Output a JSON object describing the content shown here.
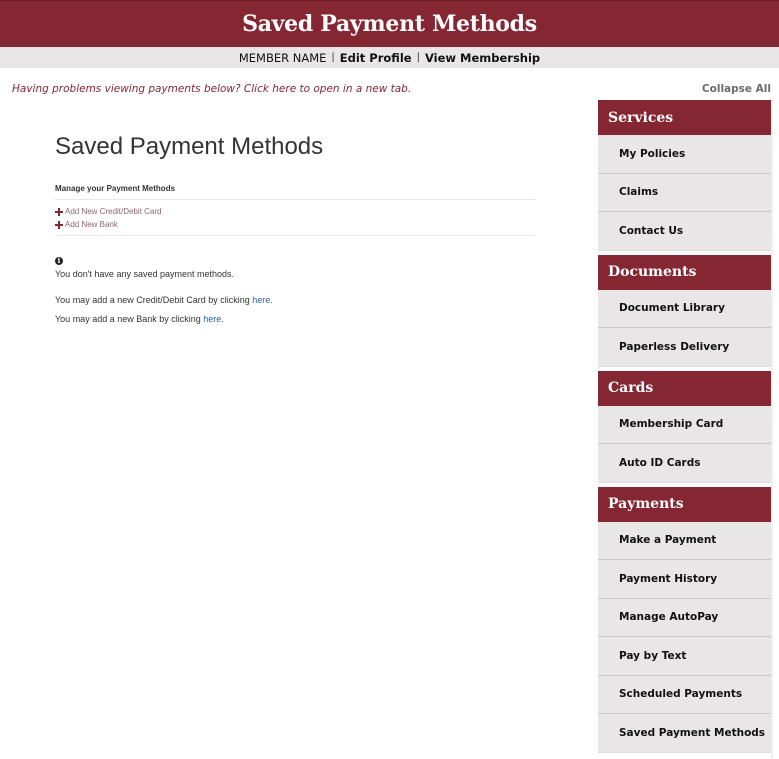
{
  "header": {
    "title": "Saved Payment Methods"
  },
  "member_bar": {
    "member_name": "MEMBER NAME",
    "separator": "|",
    "edit_profile": "Edit Profile",
    "view_membership": "View Membership"
  },
  "notice": {
    "problem_link": "Having problems viewing payments below? Click here to open in a new tab.",
    "collapse_all": "Collapse All"
  },
  "main": {
    "title": "Saved Payment Methods",
    "manage_title": "Manage your Payment Methods",
    "add_links": [
      {
        "icon": "plus-icon",
        "label": "Add New Credit/Debit Card"
      },
      {
        "icon": "plus-icon",
        "label": "Add New Bank"
      }
    ],
    "info_icon": "info-circle-icon",
    "info_glyph": "i",
    "empty_message": "You don't have any saved payment methods.",
    "hint_card_prefix": "You may add a new Credit/Debit Card by clicking ",
    "hint_card_link": "here.",
    "hint_bank_prefix": "You may add a new Bank by clicking ",
    "hint_bank_link": "here."
  },
  "sidebar": {
    "groups": [
      {
        "title": "Services",
        "items": [
          "My Policies",
          "Claims",
          "Contact Us"
        ]
      },
      {
        "title": "Documents",
        "items": [
          "Document Library",
          "Paperless Delivery"
        ]
      },
      {
        "title": "Cards",
        "items": [
          "Membership Card",
          "Auto ID Cards"
        ]
      },
      {
        "title": "Payments",
        "items": [
          "Make a Payment",
          "Payment History",
          "Manage AutoPay",
          "Pay by Text",
          "Scheduled Payments",
          "Saved Payment Methods"
        ]
      }
    ]
  },
  "colors": {
    "brand": "#852633",
    "nav_bg": "#e8e6e6",
    "link": "#2a6496"
  }
}
